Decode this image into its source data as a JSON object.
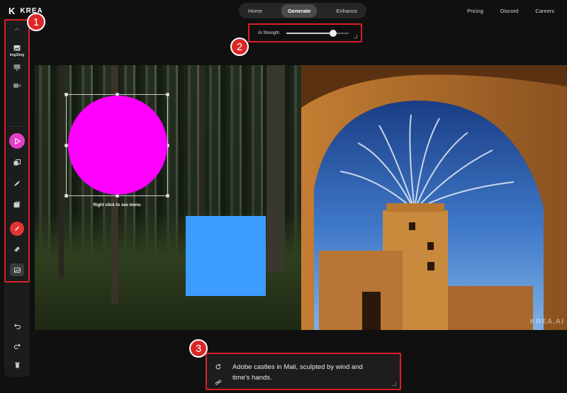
{
  "header": {
    "logo_text": "KREA",
    "tabs": [
      "Home",
      "Generate",
      "Enhance"
    ],
    "active_tab": "Generate",
    "right_links": [
      "Pricing",
      "Discord",
      "Careers"
    ]
  },
  "strength": {
    "label": "AI Strength",
    "value": 0.78
  },
  "sidebar": {
    "img2img_label": "Img2Img"
  },
  "canvas": {
    "hint": "Right click to see menu",
    "circle_color": "#ff00ff",
    "square_color": "#3d9cff",
    "watermark": "KREA.AI"
  },
  "prompt": {
    "text": "Adobe castles in Mali, sculpted by wind and\ntime's hands."
  },
  "callouts": [
    "1",
    "2",
    "3"
  ],
  "colors": {
    "accent_red": "#d91f26",
    "pointer_magenta": "#e43fc9"
  }
}
